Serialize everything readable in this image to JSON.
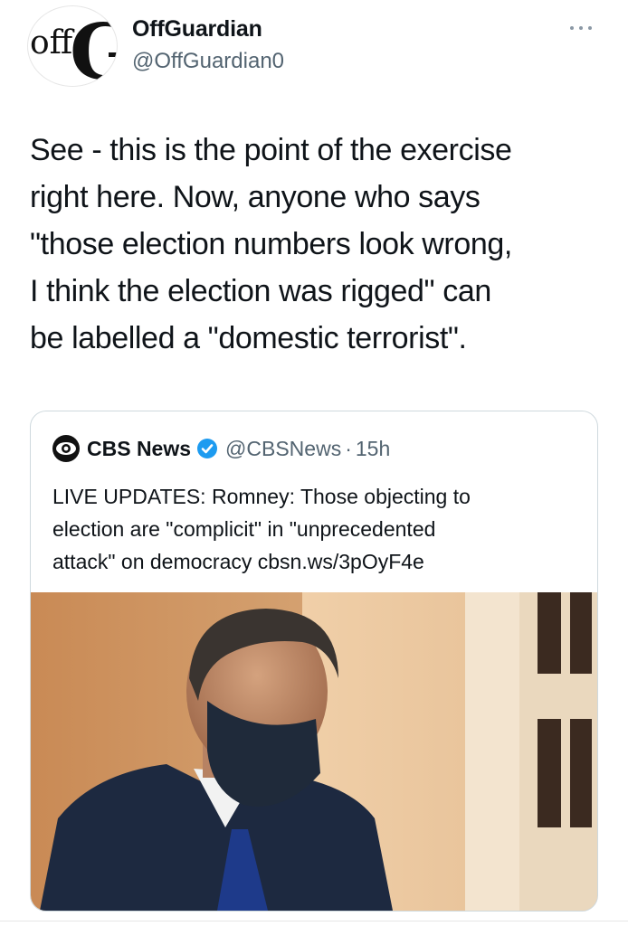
{
  "author": {
    "name": "OffGuardian",
    "handle": "@OffGuardian0",
    "avatar_logo_text": "off",
    "avatar_logo_letter": "G"
  },
  "more_icon": "more-horizontal-icon",
  "tweet_text": {
    "lines": [
      "See - this is the point of the exercise",
      "right here. Now, anyone who says",
      "\"those election numbers look wrong,",
      "I think the election was rigged\" can",
      "be labelled a \"domestic terrorist\"."
    ]
  },
  "quoted_tweet": {
    "name": "CBS News",
    "handle": "@CBSNews",
    "separator": "·",
    "time": "15h",
    "verified_icon": "verified-badge-icon",
    "text_lines": [
      "LIVE UPDATES: Romney: Those objecting to",
      "election are \"complicit\" in \"unprecedented",
      "attack\" on democracy cbsn.ws/3pOyF4e"
    ]
  },
  "colors": {
    "text": "#0f1419",
    "secondary": "#536471",
    "verified": "#1d9bf0",
    "border": "#cfd9de"
  }
}
